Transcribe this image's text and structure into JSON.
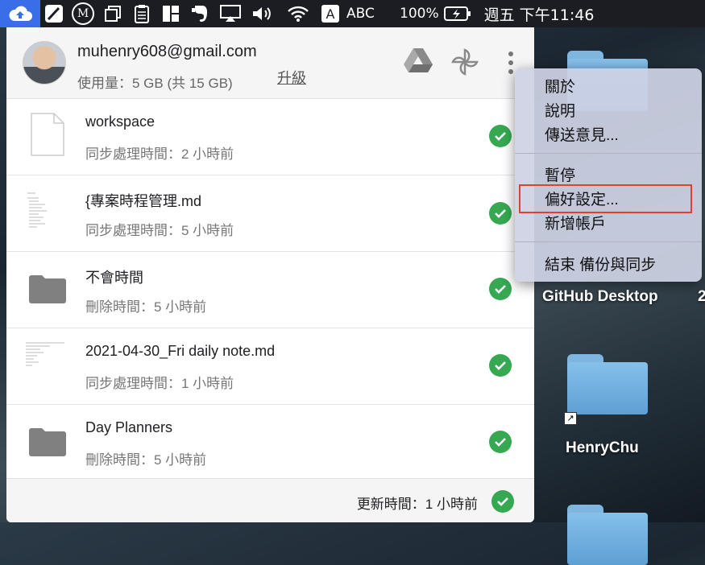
{
  "menubar": {
    "m_badge": "M",
    "input_letter": "A",
    "input_label": "ABC",
    "battery": "100%",
    "clock": "週五 下午11:46"
  },
  "account": {
    "email": "muhenry608@gmail.com",
    "usage": "使用量：5 GB (共 15 GB)",
    "upgrade": "升級"
  },
  "files": [
    {
      "name": "workspace",
      "status": "同步處理時間：2 小時前",
      "icon": "document-icon"
    },
    {
      "name": "{專案時程管理.md",
      "status": "同步處理時間：5 小時前",
      "icon": "markdown-thumbnail"
    },
    {
      "name": "不會時間",
      "status": "刪除時間：5 小時前",
      "icon": "folder-icon"
    },
    {
      "name": "2021-04-30_Fri daily note.md",
      "status": "同步處理時間：1 小時前",
      "icon": "markdown-thumbnail"
    },
    {
      "name": "Day Planners",
      "status": "刪除時間：5 小時前",
      "icon": "folder-icon"
    }
  ],
  "footer": {
    "updated": "更新時間：1 小時前"
  },
  "menu": {
    "items": [
      "關於",
      "說明",
      "傳送意見...",
      "暫停",
      "偏好設定...",
      "新增帳戶",
      "結束 備份與同步"
    ],
    "highlighted": "偏好設定..."
  },
  "desktop": {
    "icons": [
      "GitHub Desktop",
      "HenryChu"
    ],
    "edge_label": "2"
  },
  "colors": {
    "check": "#36a852",
    "highlight_border": "#e0422e",
    "menubar_active": "#3a6ee8"
  }
}
